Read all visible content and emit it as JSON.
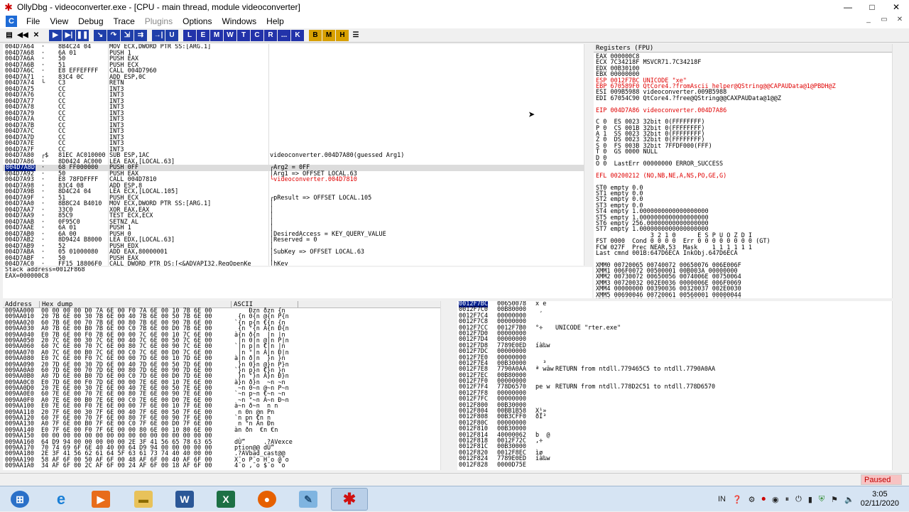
{
  "window": {
    "title": "OllyDbg - videoconverter.exe - [CPU - main thread, module videoconverter]",
    "controls": [
      "—",
      "□",
      "✕"
    ]
  },
  "menu": {
    "items": [
      "File",
      "View",
      "Debug",
      "Trace",
      "Plugins",
      "Options",
      "Windows",
      "Help"
    ],
    "disabled": [
      "Plugins"
    ],
    "mdi_controls": [
      "_",
      "▭",
      "✕"
    ]
  },
  "toolbar": {
    "letters": [
      "L",
      "E",
      "M",
      "W",
      "T",
      "C",
      "R",
      "...",
      "K",
      "B",
      "M",
      "H"
    ]
  },
  "cpu": {
    "selected_index": 20,
    "rows": [
      {
        "addr": "004D7A64",
        "mark": "·",
        "hex": "8B4C24 04",
        "dis": "MOV ECX,DWORD PTR SS:[ARG.1]",
        "cmt": ""
      },
      {
        "addr": "004D7A68",
        "mark": "·",
        "hex": "6A 01",
        "dis": "PUSH 1",
        "cmt": ""
      },
      {
        "addr": "004D7A6A",
        "mark": "·",
        "hex": "50",
        "dis": "PUSH EAX",
        "cmt": ""
      },
      {
        "addr": "004D7A6B",
        "mark": "·",
        "hex": "51",
        "dis": "PUSH ECX",
        "cmt": ""
      },
      {
        "addr": "004D7A6C",
        "mark": "·",
        "hex": "E8 EFFEFFFF",
        "dis": "CALL 004D7960",
        "cmt": ""
      },
      {
        "addr": "004D7A71",
        "mark": "·",
        "hex": "83C4 0C",
        "dis": "ADD ESP,0C",
        "cmt": ""
      },
      {
        "addr": "004D7A74",
        "mark": "└",
        "hex": "C3",
        "dis": "RETN",
        "cmt": ""
      },
      {
        "addr": "004D7A75",
        "mark": "",
        "hex": "CC",
        "dis": "INT3",
        "cmt": ""
      },
      {
        "addr": "004D7A76",
        "mark": "",
        "hex": "CC",
        "dis": "INT3",
        "cmt": ""
      },
      {
        "addr": "004D7A77",
        "mark": "",
        "hex": "CC",
        "dis": "INT3",
        "cmt": ""
      },
      {
        "addr": "004D7A78",
        "mark": "",
        "hex": "CC",
        "dis": "INT3",
        "cmt": ""
      },
      {
        "addr": "004D7A79",
        "mark": "",
        "hex": "CC",
        "dis": "INT3",
        "cmt": ""
      },
      {
        "addr": "004D7A7A",
        "mark": "",
        "hex": "CC",
        "dis": "INT3",
        "cmt": ""
      },
      {
        "addr": "004D7A7B",
        "mark": "",
        "hex": "CC",
        "dis": "INT3",
        "cmt": ""
      },
      {
        "addr": "004D7A7C",
        "mark": "",
        "hex": "CC",
        "dis": "INT3",
        "cmt": ""
      },
      {
        "addr": "004D7A7D",
        "mark": "",
        "hex": "CC",
        "dis": "INT3",
        "cmt": ""
      },
      {
        "addr": "004D7A7E",
        "mark": "",
        "hex": "CC",
        "dis": "INT3",
        "cmt": ""
      },
      {
        "addr": "004D7A7F",
        "mark": "",
        "hex": "CC",
        "dis": "INT3",
        "cmt": ""
      },
      {
        "addr": "004D7A80",
        "mark": "┌$",
        "hex": "81EC AC010000",
        "dis": "SUB ESP,1AC",
        "cmt": "videoconverter.004D7A80(guessed Arg1)"
      },
      {
        "addr": "004D7A86",
        "mark": "·",
        "hex": "8D0424 AC000",
        "dis": "LEA EAX,[LOCAL.63]",
        "cmt": ""
      },
      {
        "addr": "004D7A8D",
        "mark": "·",
        "hex": "68 FF000000",
        "dis": "PUSH 0FF",
        "cmt": "┌Arg2 = 0FF"
      },
      {
        "addr": "004D7A92",
        "mark": "·",
        "hex": "50",
        "dis": "PUSH EAX",
        "cmt": "│Arg1 => OFFSET LOCAL.63"
      },
      {
        "addr": "004D7A93",
        "mark": "·",
        "hex": "E8 78FDFFFF",
        "dis": "CALL 004D7810",
        "cmt": "└videoconverter.004D7810"
      },
      {
        "addr": "004D7A98",
        "mark": "·",
        "hex": "83C4 08",
        "dis": "ADD ESP,8",
        "cmt": ""
      },
      {
        "addr": "004D7A9B",
        "mark": "·",
        "hex": "8D4C24 04",
        "dis": "LEA ECX,[LOCAL.105]",
        "cmt": ""
      },
      {
        "addr": "004D7A9F",
        "mark": "·",
        "hex": "51",
        "dis": "PUSH ECX",
        "cmt": "┌pResult => OFFSET LOCAL.105"
      },
      {
        "addr": "004D7AA0",
        "mark": "·",
        "hex": "8B8C24 B4010",
        "dis": "MOV ECX,DWORD PTR SS:[ARG.1]",
        "cmt": "│"
      },
      {
        "addr": "004D7AA7",
        "mark": "·",
        "hex": "33C0",
        "dis": "XOR EAX,EAX",
        "cmt": "│"
      },
      {
        "addr": "004D7AA9",
        "mark": "·",
        "hex": "85C9",
        "dis": "TEST ECX,ECX",
        "cmt": "│"
      },
      {
        "addr": "004D7AAB",
        "mark": "·",
        "hex": "0F95C0",
        "dis": "SETNZ AL",
        "cmt": "│"
      },
      {
        "addr": "004D7AAE",
        "mark": "·",
        "hex": "6A 01",
        "dis": "PUSH 1",
        "cmt": "│"
      },
      {
        "addr": "004D7AB0",
        "mark": "·",
        "hex": "6A 00",
        "dis": "PUSH 0",
        "cmt": "│DesiredAccess = KEY_QUERY_VALUE"
      },
      {
        "addr": "004D7AB2",
        "mark": "·",
        "hex": "8D9424 B8000",
        "dis": "LEA EDX,[LOCAL.63]",
        "cmt": "│Reserved = 0"
      },
      {
        "addr": "004D7AB9",
        "mark": "·",
        "hex": "52",
        "dis": "PUSH EDX",
        "cmt": "│"
      },
      {
        "addr": "004D7ABA",
        "mark": "·",
        "hex": "05 01000080",
        "dis": "ADD EAX,80000001",
        "cmt": "│SubKey => OFFSET LOCAL.63"
      },
      {
        "addr": "004D7ABF",
        "mark": "·",
        "hex": "50",
        "dis": "PUSH EAX",
        "cmt": "│"
      },
      {
        "addr": "004D7AC0",
        "mark": "·",
        "hex": "FF15 18806F0",
        "dis": "CALL DWORD PTR DS:[<&ADVAPI32.RegOpenKe",
        "cmt": "│hKey"
      }
    ],
    "red_comments": [
      "└videoconverter.004D7810",
      "ADVAPI32.RegOpenKeyExA"
    ],
    "last_comment": "└ADVAPI32.RegOpenKeyExA"
  },
  "info": {
    "line1": "Stack address=0012F868",
    "line2": "EAX=000000C8"
  },
  "registers": {
    "header": "Registers (FPU)",
    "lines": [
      "EAX 000000C8",
      "ECX 7C34218F MSVCR71.7C34218F",
      "EDX 00B30100",
      "EBX 00000000",
      "ESP 0012F7BC UNICODE \"xe\"",
      "EBP 670589F0 QtCore4.?fromAscii_helper@QString@@CAPAUData@1@PBDH@Z",
      "ESI 009B5988 videoconverter.009B5988",
      "EDI 67054C90 QtCore4.?free@QString@@CAXPAUData@1@@Z",
      "",
      "EIP 004D7A86 videoconverter.004D7A86",
      "",
      "C 0  ES 0023 32bit 0(FFFFFFFF)",
      "P 0  CS 001B 32bit 0(FFFFFFFF)",
      "A 1  SS 0023 32bit 0(FFFFFFFF)",
      "Z 0  DS 0023 32bit 0(FFFFFFFF)",
      "S 0  FS 003B 32bit 7FFDF000(FFF)",
      "T 0  GS 0000 NULL",
      "D 0",
      "O 0  LastErr 00000000 ERROR_SUCCESS",
      "",
      "EFL 00200212 (NO,NB,NE,A,NS,PO,GE,G)",
      "",
      "ST0 empty 0.0",
      "ST1 empty 0.0",
      "ST2 empty 0.0",
      "ST3 empty 0.0",
      "ST4 empty 1.0000000000000000000",
      "ST5 empty 1.0000000000000000000",
      "ST6 empty 256.00000000000000000",
      "ST7 empty 1.0000000000000000000",
      "               3 2 1 0      E S P U O Z D I",
      "FST 0000  Cond 0 0 0 0  Err 0 0 0 0 0 0 0 0 (GT)",
      "FCW 027F  Prec NEAR,53  Mask    1 1 1 1 1 1",
      "Last cmnd 001B:647D6ECA InkObj.647D6ECA",
      "",
      "XMM0 00720065 00740072 00650076 006E006F",
      "XMM1 006F0072 00500001 00B003A 00000000",
      "XMM2 00730072 00650056 0074006E 00750064",
      "XMM3 00720032 002E0036 0000006E 006F0069",
      "XMM4 00000000 00390036 00320037 002E0030",
      "XMM5 00690046 00720061 00560001 00000044",
      "XMM6 00000000 006F0066 006E0049 0065006C",
      "XMM7 0073006E 00610072 00540000 00400024"
    ],
    "red_values": [
      "0012F7BC",
      "670589F0",
      "004D7A86",
      "00200212"
    ]
  },
  "dump": {
    "headers": [
      "Address",
      "Hex dump",
      "ASCII"
    ],
    "rows": [
      {
        "a": "009AA000",
        "h": "00 00 00 00 D0 7A 6E 00 F0 7A 6E 00 10 7B 6E 00",
        "s": "    Ðzn ðzn {n "
      },
      {
        "a": "009AA010",
        "h": "20 7B 6E 00 30 7B 6E 00 40 7B 6E 00 50 7B 6E 00",
        "s": " {n 0{n @{n P{n"
      },
      {
        "a": "009AA020",
        "h": "60 7B 6E 00 70 7B 6E 00 80 7B 6E 00 90 7B 6E 00",
        "s": "`{n p{n €{n {n"
      },
      {
        "a": "009AA030",
        "h": "A0 7B 6E 00 B0 7B 6E 00 C0 7B 6E 00 D0 7B 6E 00",
        "s": " {n °{n À{n Ð{n"
      },
      {
        "a": "009AA040",
        "h": "E0 7B 6E 00 F0 7B 6E 00 00 7C 6E 00 10 7C 6E 00",
        "s": "à{n ð{n  |n |n"
      },
      {
        "a": "009AA050",
        "h": "20 7C 6E 00 30 7C 6E 00 40 7C 6E 00 50 7C 6E 00",
        "s": " |n 0|n @|n P|n"
      },
      {
        "a": "009AA060",
        "h": "60 7C 6E 00 70 7C 6E 00 80 7C 6E 00 90 7C 6E 00",
        "s": "`|n p|n €|n |n"
      },
      {
        "a": "009AA070",
        "h": "A0 7C 6E 00 B0 7C 6E 00 C0 7C 6E 00 D0 7C 6E 00",
        "s": " |n °|n À|n Ð|n"
      },
      {
        "a": "009AA080",
        "h": "E0 7C 6E 00 F0 7C 6E 00 00 7D 6E 00 10 7D 6E 00",
        "s": "à|n ð|n  }n }n"
      },
      {
        "a": "009AA090",
        "h": "20 7D 6E 00 30 7D 6E 00 40 7D 6E 00 50 7D 6E 00",
        "s": " }n 0}n @}n P}n"
      },
      {
        "a": "009AA0A0",
        "h": "60 7D 6E 00 70 7D 6E 00 80 7D 6E 00 90 7D 6E 00",
        "s": "`}n p}n €}n }n"
      },
      {
        "a": "009AA0B0",
        "h": "A0 7D 6E 00 B0 7D 6E 00 C0 7D 6E 00 D0 7D 6E 00",
        "s": " }n °}n À}n Ð}n"
      },
      {
        "a": "009AA0C0",
        "h": "E0 7D 6E 00 F0 7D 6E 00 00 7E 6E 00 10 7E 6E 00",
        "s": "à}n ð}n  ~n ~n"
      },
      {
        "a": "009AA0D0",
        "h": "20 7E 6E 00 30 7E 6E 00 40 7E 6E 00 50 7E 6E 00",
        "s": " ~n 0~n @~n P~n"
      },
      {
        "a": "009AA0E0",
        "h": "60 7E 6E 00 70 7E 6E 00 80 7E 6E 00 90 7E 6E 00",
        "s": "`~n p~n €~n ~n"
      },
      {
        "a": "009AA0F0",
        "h": "A0 7E 6E 00 B0 7E 6E 00 C0 7E 6E 00 D0 7E 6E 00",
        "s": " ~n °~n À~n Ð~n"
      },
      {
        "a": "009AA100",
        "h": "E0 7E 6E 00 F0 7E 6E 00 00 7F 6E 00 10 7F 6E 00",
        "s": "à~n ð~n  n n"
      },
      {
        "a": "009AA110",
        "h": "20 7F 6E 00 30 7F 6E 00 40 7F 6E 00 50 7F 6E 00",
        "s": " n 0n @n Pn"
      },
      {
        "a": "009AA120",
        "h": "60 7F 6E 00 70 7F 6E 00 80 7F 6E 00 90 7F 6E 00",
        "s": "`n pn €n n"
      },
      {
        "a": "009AA130",
        "h": "A0 7F 6E 00 B0 7F 6E 00 C0 7F 6E 00 D0 7F 6E 00",
        "s": " n °n Àn Ðn"
      },
      {
        "a": "009AA140",
        "h": "E0 7F 6E 00 F0 7F 6E 00 00 80 6E 00 10 80 6E 00",
        "s": "àn ðn  €n €n"
      },
      {
        "a": "009AA150",
        "h": "00 00 00 00 00 00 00 00 00 00 00 00 00 00 00 00",
        "s": "                "
      },
      {
        "a": "009AA160",
        "h": "64 D9 94 00 00 00 00 00 2E 3F 41 56 65 78 63 65",
        "s": "dÙ”     .?AVexce"
      },
      {
        "a": "009AA170",
        "h": "70 74 69 6F 6E 40 40 00 64 D9 94 00 00 00 00 00",
        "s": "ption@@ dÙ”     "
      },
      {
        "a": "009AA180",
        "h": "2E 3F 41 56 62 61 64 5F 63 61 73 74 40 40 00 00",
        "s": ".?AVbad_cast@@  "
      },
      {
        "a": "009AA190",
        "h": "58 AF 6F 00 50 AF 6F 00 48 AF 6F 00 40 AF 6F 00",
        "s": "X¯o P¯o H¯o @¯o "
      },
      {
        "a": "009AA1A0",
        "h": "34 AF 6F 00 2C AF 6F 00 24 AF 6F 00 18 AF 6F 00",
        "s": "4¯o ,¯o $¯o ¯o "
      }
    ]
  },
  "stack": {
    "rows": [
      {
        "a": "0012F7BC",
        "v": "00650078",
        "s": "x e",
        "c": ""
      },
      {
        "a": "0012F7C0",
        "v": "00B80000",
        "s": " ¸",
        "c": ""
      },
      {
        "a": "0012F7C4",
        "v": "00000000",
        "s": "",
        "c": ""
      },
      {
        "a": "0012F7C8",
        "v": "00000000",
        "s": "",
        "c": ""
      },
      {
        "a": "0012F7CC",
        "v": "0012F7B0",
        "s": "°÷",
        "c": "UNICODE \"rter.exe\""
      },
      {
        "a": "0012F7D0",
        "v": "00000000",
        "s": "",
        "c": ""
      },
      {
        "a": "0012F7D4",
        "v": "00000000",
        "s": "",
        "c": ""
      },
      {
        "a": "0012F7D8",
        "v": "7789E0ED",
        "s": "íà‰w",
        "c": ""
      },
      {
        "a": "0012F7DC",
        "v": "00000000",
        "s": "",
        "c": ""
      },
      {
        "a": "0012F7E0",
        "v": "00000000",
        "s": "",
        "c": ""
      },
      {
        "a": "0012F7E4",
        "v": "00B30000",
        "s": "  ³",
        "c": ""
      },
      {
        "a": "0012F7E8",
        "v": "7790A0AA",
        "s": "ª wäw",
        "c": "RETURN from ntdll.779465C5 to ntdll.7790A0AA"
      },
      {
        "a": "0012F7EC",
        "v": "00B80000",
        "s": "",
        "c": ""
      },
      {
        "a": "0012F7F0",
        "v": "00000000",
        "s": "",
        "c": ""
      },
      {
        "a": "0012F7F4",
        "v": "778D6570",
        "s": "pe w",
        "c": "RETURN from ntdll.778D2C51 to ntdll.778D6570"
      },
      {
        "a": "0012F7F8",
        "v": "00000000",
        "s": "",
        "c": ""
      },
      {
        "a": "0012F7FC",
        "v": "00000000",
        "s": "",
        "c": ""
      },
      {
        "a": "0012F800",
        "v": "00B30000",
        "s": "",
        "c": ""
      },
      {
        "a": "0012F804",
        "v": "00BB1B58",
        "s": "X¹»",
        "c": ""
      },
      {
        "a": "0012F808",
        "v": "00B3CFF0",
        "s": "ðÏ³",
        "c": ""
      },
      {
        "a": "0012F80C",
        "v": "00000000",
        "s": "",
        "c": ""
      },
      {
        "a": "0012F810",
        "v": "00B30000",
        "s": "",
        "c": ""
      },
      {
        "a": "0012F814",
        "v": "40000062",
        "s": "b  @",
        "c": ""
      },
      {
        "a": "0012F818",
        "v": "0012F72C",
        "s": ",÷",
        "c": ""
      },
      {
        "a": "0012F81C",
        "v": "00B30000",
        "s": "",
        "c": ""
      },
      {
        "a": "0012F820",
        "v": "0012F8EC",
        "s": "ìø",
        "c": ""
      },
      {
        "a": "0012F824",
        "v": "7789E0ED",
        "s": "íà‰w",
        "c": ""
      },
      {
        "a": "0012F828",
        "v": "0000D75E",
        "s": "",
        "c": ""
      }
    ]
  },
  "status": {
    "paused": "Paused"
  },
  "taskbar": {
    "apps": [
      "start",
      "ie",
      "media",
      "explorer",
      "word",
      "excel",
      "firefox",
      "notepad",
      "ollydbg"
    ],
    "tray_lang": "IN",
    "time": "3:05",
    "date": "02/11/2020"
  }
}
